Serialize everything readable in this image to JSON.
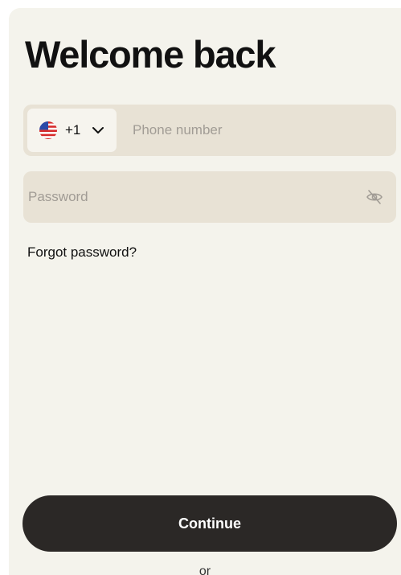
{
  "screen": {
    "title": "Welcome back"
  },
  "phone": {
    "country_flag": "us-flag-icon",
    "dial_code": "+1",
    "placeholder": "Phone number",
    "value": ""
  },
  "password": {
    "placeholder": "Password",
    "value": "",
    "toggle_icon": "eye-off-icon"
  },
  "links": {
    "forgot_password": "Forgot password?"
  },
  "actions": {
    "continue_label": "Continue",
    "divider_label": "or"
  },
  "colors": {
    "background": "#f4f3ec",
    "field": "#e8e2d5",
    "primary_button": "#2b2826",
    "text": "#111111",
    "placeholder": "#a19c95"
  }
}
